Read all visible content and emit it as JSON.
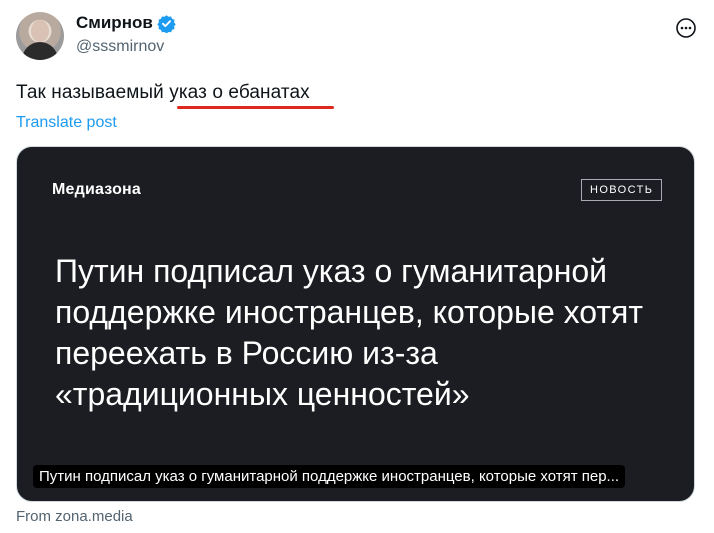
{
  "author": {
    "display_name": "Смирнов",
    "handle": "@sssmirnov"
  },
  "tweet": {
    "text_before": "Так называемый ",
    "text_highlight": "указ о ебанатах",
    "translate_label": "Translate post"
  },
  "card": {
    "brand": "Медиазона",
    "badge": "НОВОСТЬ",
    "headline": "Путин подписал указ о гуманитарной поддержке иностранцев, которые хотят переехать в Россию из-за «традиционных ценностей»",
    "caption": "Путин подписал указ о гуманитарной поддержке иностранцев, которые хотят пер...",
    "source": "From zona.media"
  },
  "colors": {
    "link": "#1d9bf0",
    "verified": "#1d9bf0",
    "underline": "#e0291e",
    "card_bg": "#1c1d22"
  },
  "icons": [
    "verified-badge-icon",
    "more-options-icon"
  ]
}
